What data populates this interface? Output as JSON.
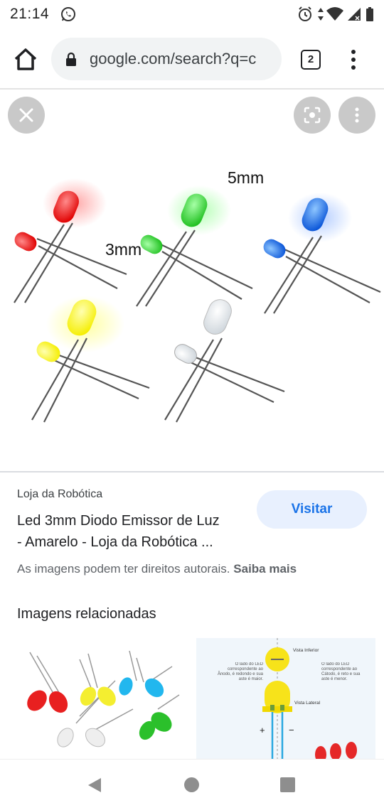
{
  "status_bar": {
    "time": "21:14",
    "icons": [
      "whatsapp-icon",
      "alarm-icon",
      "data-arrows-icon",
      "wifi-icon",
      "signal-icon",
      "battery-icon"
    ]
  },
  "browser": {
    "url": "google.com/search?q=c",
    "tab_count": "2",
    "icons": [
      "home-icon",
      "lock-icon",
      "tabs-icon",
      "overflow-menu-icon"
    ]
  },
  "viewer": {
    "icons": [
      "close-icon",
      "lens-search-icon",
      "more-vert-icon"
    ],
    "image_labels": {
      "large": "5mm",
      "small": "3mm"
    }
  },
  "result": {
    "source": "Loja da Robótica",
    "title_line1": "Led 3mm Diodo Emissor de Luz",
    "title_line2": "- Amarelo - Loja da Robótica ...",
    "visit_label": "Visitar",
    "rights_text": "As imagens podem ter direitos autorais.",
    "rights_link": "Saiba mais"
  },
  "related": {
    "title": "Imagens relacionadas",
    "thumb2_labels": {
      "top_label": "Vista Inferior",
      "side_label": "Vista Lateral",
      "left_note": "O lado do LED correspondente ao Ânodo, é redondo e sua aste é maior.",
      "right_note": "O lado do LED correspondente ao Cátodo, é reto e sua aste é menor.",
      "plus": "+",
      "minus": "−"
    }
  },
  "nav": {
    "icons": [
      "back-icon",
      "home-circle-icon",
      "recents-icon"
    ]
  },
  "colors": {
    "accent": "#1a73e8",
    "visit_bg": "#e8f0fe",
    "url_bar_bg": "#f1f3f4",
    "viewer_button": "#c9c9c9"
  }
}
